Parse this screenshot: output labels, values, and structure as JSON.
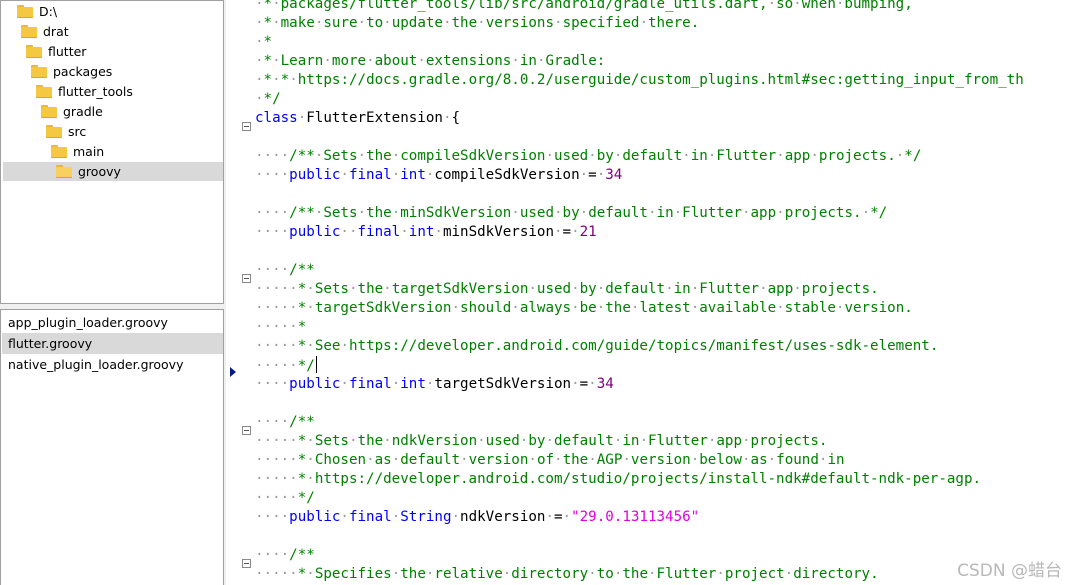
{
  "tree": {
    "items": [
      {
        "label": "D:\\",
        "selected": false
      },
      {
        "label": "drat",
        "selected": false
      },
      {
        "label": "flutter",
        "selected": false
      },
      {
        "label": "packages",
        "selected": false
      },
      {
        "label": "flutter_tools",
        "selected": false
      },
      {
        "label": "gradle",
        "selected": false
      },
      {
        "label": "src",
        "selected": false
      },
      {
        "label": "main",
        "selected": false
      },
      {
        "label": "groovy",
        "selected": true
      }
    ]
  },
  "files": {
    "items": [
      {
        "label": "app_plugin_loader.groovy",
        "selected": false
      },
      {
        "label": "flutter.groovy",
        "selected": true
      },
      {
        "label": "native_plugin_loader.groovy",
        "selected": false
      }
    ]
  },
  "editor": {
    "lines": [
      " * packages/flutter_tools/lib/src/android/gradle_utils.dart, so when bumping,",
      " * make sure to update the versions specified there.",
      " *",
      " * Learn more about extensions in Gradle:",
      " * * https://docs.gradle.org/8.0.2/userguide/custom_plugins.html#sec:getting_input_from_th",
      " */",
      "class FlutterExtension {",
      "",
      "    /** Sets the compileSdkVersion used by default in Flutter app projects. */",
      "    public final int compileSdkVersion = 34",
      "",
      "    /** Sets the minSdkVersion used by default in Flutter app projects. */",
      "    public  final int minSdkVersion = 21",
      "",
      "    /**",
      "     * Sets the targetSdkVersion used by default in Flutter app projects.",
      "     * targetSdkVersion should always be the latest available stable version.",
      "     *",
      "     * See https://developer.android.com/guide/topics/manifest/uses-sdk-element.",
      "     */",
      "    public final int targetSdkVersion = 34",
      "",
      "    /**",
      "     * Sets the ndkVersion used by default in Flutter app projects.",
      "     * Chosen as default version of the AGP version below as found in",
      "     * https://developer.android.com/studio/projects/install-ndk#default-ndk-per-agp.",
      "     */",
      "    public final String ndkVersion = \"29.0.13113456\"",
      "",
      "    /**",
      "     * Specifies the relative directory to the Flutter project directory."
    ]
  },
  "watermark": "CSDN @蜡台"
}
